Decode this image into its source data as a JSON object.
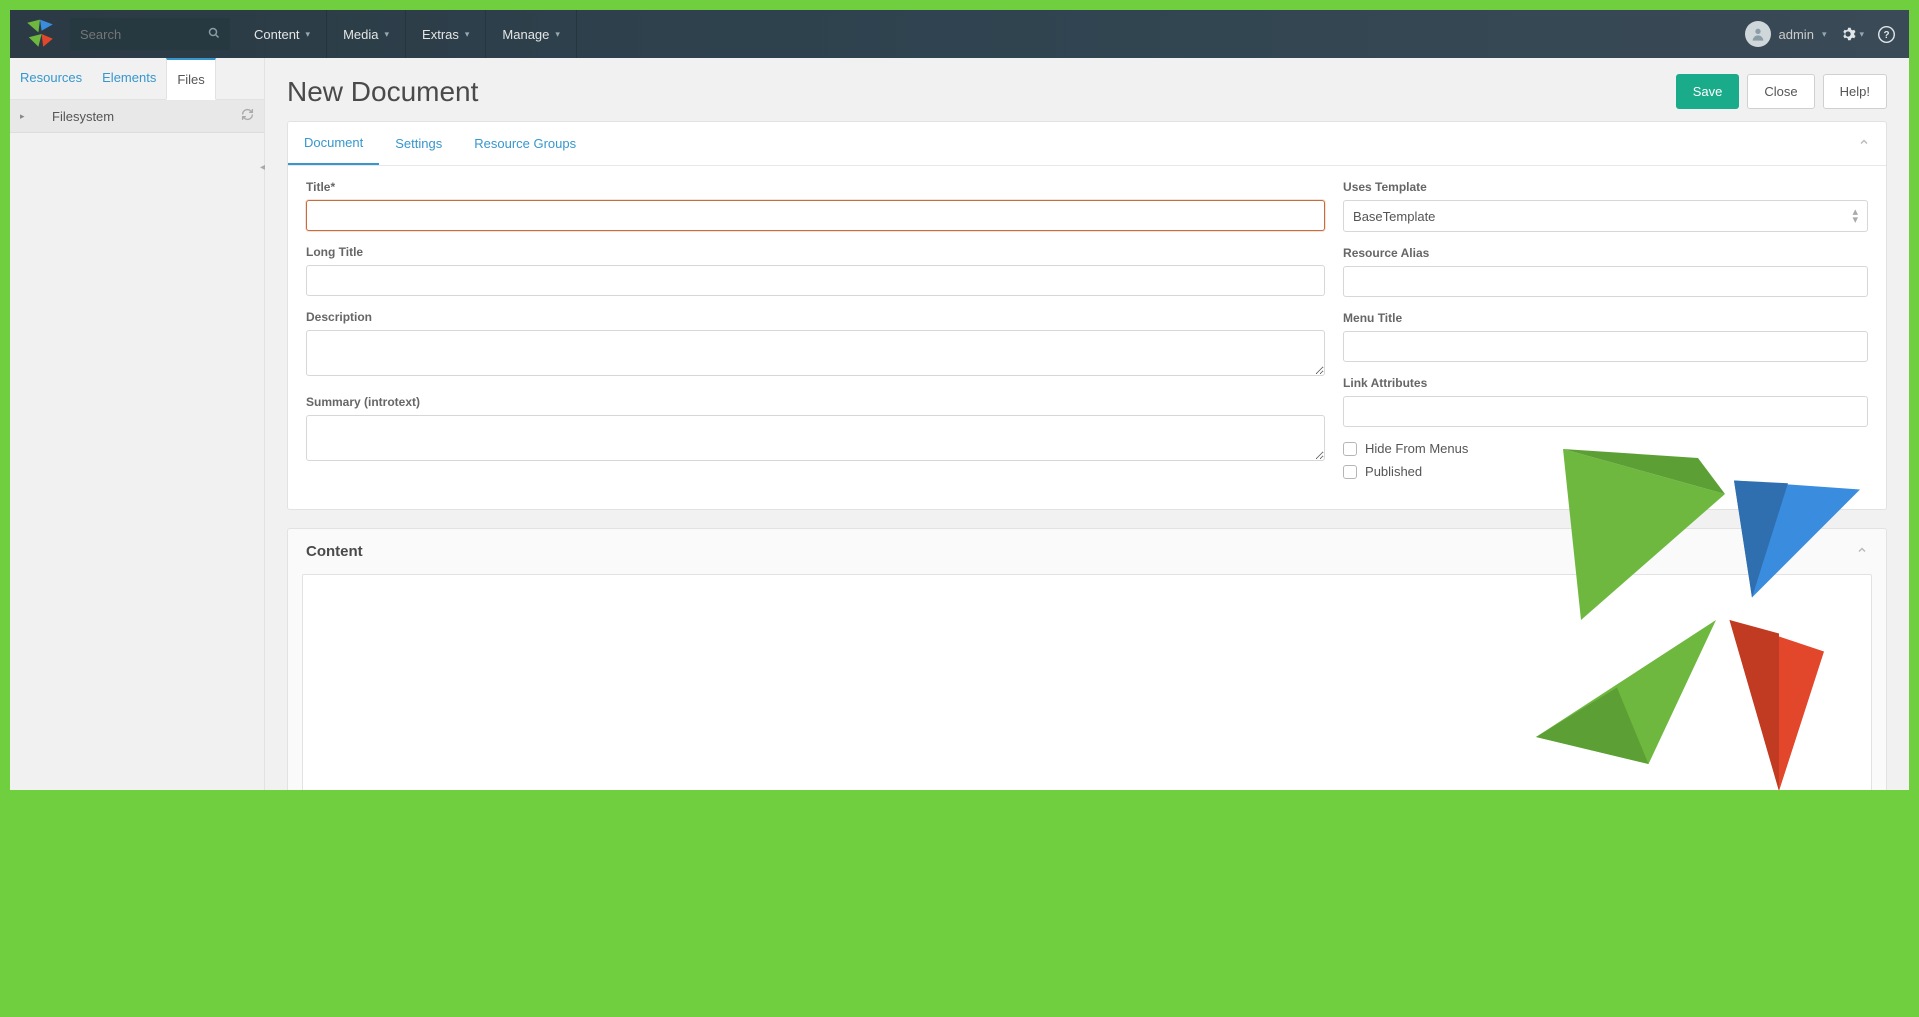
{
  "search": {
    "placeholder": "Search"
  },
  "nav": {
    "items": [
      {
        "label": "Content"
      },
      {
        "label": "Media"
      },
      {
        "label": "Extras"
      },
      {
        "label": "Manage"
      }
    ]
  },
  "user": {
    "name": "admin"
  },
  "sidebar": {
    "tabs": [
      {
        "label": "Resources"
      },
      {
        "label": "Elements"
      },
      {
        "label": "Files"
      }
    ],
    "tree": {
      "root_label": "Filesystem"
    }
  },
  "page": {
    "title": "New Document",
    "buttons": {
      "save": "Save",
      "close": "Close",
      "help": "Help!"
    }
  },
  "doc_tabs": [
    {
      "label": "Document"
    },
    {
      "label": "Settings"
    },
    {
      "label": "Resource Groups"
    }
  ],
  "form": {
    "left": {
      "title_label": "Title*",
      "title_value": "",
      "long_title_label": "Long Title",
      "long_title_value": "",
      "description_label": "Description",
      "description_value": "",
      "summary_label": "Summary (introtext)",
      "summary_value": ""
    },
    "right": {
      "template_label": "Uses Template",
      "template_value": "BaseTemplate",
      "alias_label": "Resource Alias",
      "alias_value": "",
      "menu_title_label": "Menu Title",
      "menu_title_value": "",
      "link_attrs_label": "Link Attributes",
      "link_attrs_value": "",
      "hide_menus_label": "Hide From Menus",
      "published_label": "Published"
    }
  },
  "content_section": {
    "title": "Content"
  }
}
